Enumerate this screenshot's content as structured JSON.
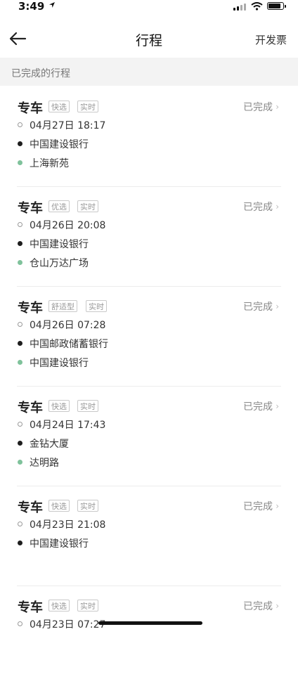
{
  "status_bar": {
    "time": "3:49"
  },
  "nav": {
    "title": "行程",
    "invoice": "开发票"
  },
  "section": {
    "label": "已完成的行程"
  },
  "trips": [
    {
      "type": "专车",
      "tags": [
        "快选",
        "实时"
      ],
      "status": "已完成",
      "time": "04月27日 18:17",
      "from": "中国建设银行",
      "to": "上海新苑"
    },
    {
      "type": "专车",
      "tags": [
        "优选",
        "实时"
      ],
      "status": "已完成",
      "time": "04月26日 20:08",
      "from": "中国建设银行",
      "to": "仓山万达广场"
    },
    {
      "type": "专车",
      "tags": [
        "舒适型",
        "实时"
      ],
      "status": "已完成",
      "time": "04月26日 07:28",
      "from": "中国邮政储蓄银行",
      "to": "中国建设银行"
    },
    {
      "type": "专车",
      "tags": [
        "快选",
        "实时"
      ],
      "status": "已完成",
      "time": "04月24日 17:43",
      "from": "金钻大厦",
      "to": "达明路"
    },
    {
      "type": "专车",
      "tags": [
        "快选",
        "实时"
      ],
      "status": "已完成",
      "time": "04月23日 21:08",
      "from": "中国建设银行",
      "to": ""
    },
    {
      "type": "专车",
      "tags": [
        "快选",
        "实时"
      ],
      "status": "已完成",
      "time": "04月23日 07:27",
      "from": "",
      "to": ""
    }
  ],
  "colors": {
    "end_dot": "#7fc29b",
    "start_dot": "#1e1e1e",
    "section_bg": "#f3f3f3"
  }
}
